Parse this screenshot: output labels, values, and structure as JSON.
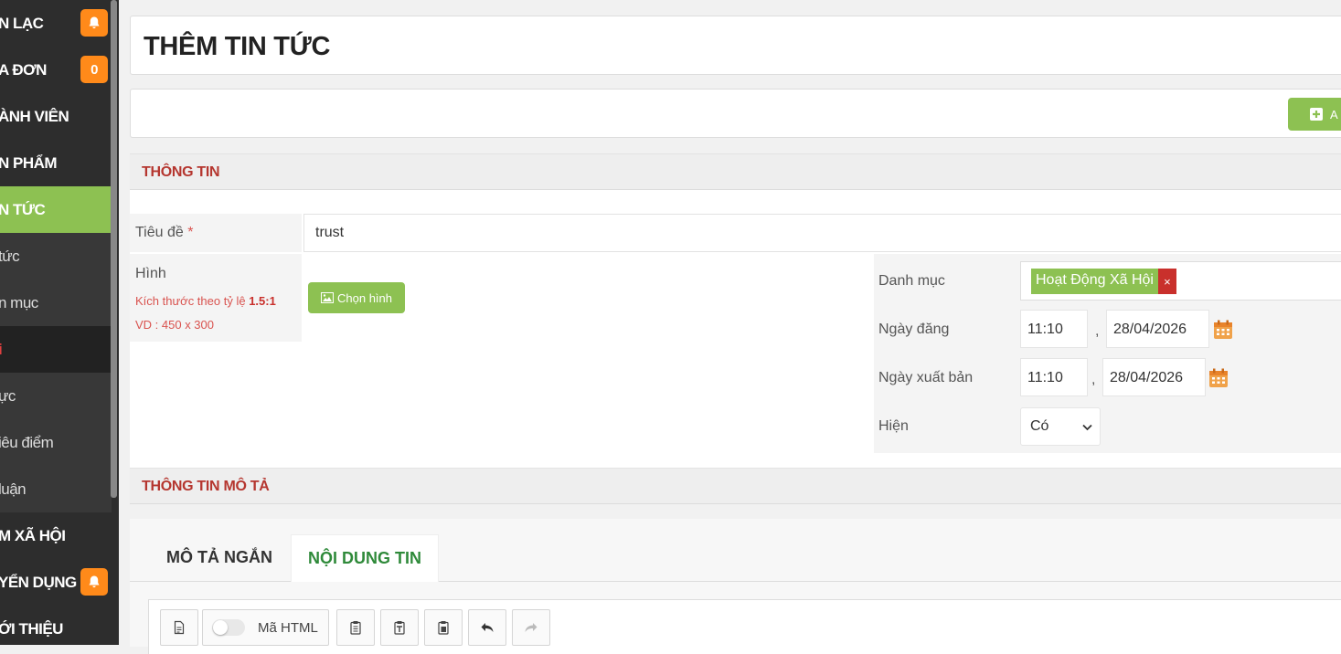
{
  "sidebar": {
    "items": [
      {
        "label": "N LẠC",
        "badge": "",
        "badge_icon": "bell-icon"
      },
      {
        "label": "A ĐƠN",
        "badge": "0"
      },
      {
        "label": "ÀNH VIÊN"
      },
      {
        "label": "N PHẨM"
      },
      {
        "label": "N TỨC"
      },
      {
        "label": "tức"
      },
      {
        "label": "n mục"
      },
      {
        "label": "i"
      },
      {
        "label": "ực"
      },
      {
        "label": "iêu điểm"
      },
      {
        "label": "luận"
      },
      {
        "label": "M XÃ HỘI"
      },
      {
        "label": "YỂN DỤNG",
        "badge_icon": "bell-icon"
      },
      {
        "label": "ỚI THIỆU"
      }
    ]
  },
  "header": {
    "title": "THÊM TIN TỨC"
  },
  "toolbar": {
    "add_label": "A"
  },
  "sections": {
    "info": "THÔNG TIN",
    "description": "THÔNG TIN MÔ TẢ"
  },
  "form": {
    "title_label": "Tiêu đề",
    "title_required": "*",
    "title_value": "trust",
    "image_label": "Hình",
    "image_hint_prefix": "Kích thước theo tỷ lệ",
    "image_hint_ratio": "1.5:1",
    "image_hint_example": "VD : 450 x 300",
    "choose_image_label": "Chọn hình",
    "category_label": "Danh mục",
    "category_tag": "Hoạt Động Xã Hội",
    "category_remove": "×",
    "publish_date_label": "Ngày đăng",
    "publish_time": "11:10",
    "publish_date": "28/04/2026",
    "release_date_label": "Ngày xuất bản",
    "release_time": "11:10",
    "release_date": "28/04/2026",
    "comma": ",",
    "show_label": "Hiện",
    "show_value": "Có"
  },
  "tabs": [
    {
      "label": "MÔ TẢ NGẮN",
      "active": false
    },
    {
      "label": "NỘI DUNG TIN",
      "active": true
    }
  ],
  "editor": {
    "html_mode_label": "Mã HTML"
  },
  "colors": {
    "accent": "#8dc152",
    "danger": "#c9302c",
    "section_title": "#b5362f",
    "sidebar_bg": "#2d2d2d",
    "badge": "#ff8a1a"
  }
}
